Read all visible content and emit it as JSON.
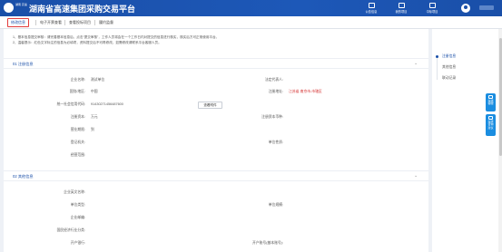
{
  "header": {
    "logo_text": "湖南\n高速",
    "title": "湖南省高速集团采购交易平台",
    "nav": [
      {
        "label": "公告信息",
        "icon": "announcement-icon"
      },
      {
        "label": "我的项目",
        "icon": "project-icon"
      },
      {
        "label": "中标项目",
        "icon": "winning-bid-icon"
      }
    ]
  },
  "tabs": [
    {
      "label": "修改信息",
      "active": true
    },
    {
      "label": "电子开票查看",
      "active": false
    },
    {
      "label": "查看投标项目",
      "active": false
    },
    {
      "label": "履约监督",
      "active": false
    }
  ],
  "notices": [
    "1、基本信息提交审核：请完善基本信息后，点击“提交审核”，工作人员将会在一个工作日内对提交的信息进行核实，核实后方可正常使用平台。",
    "2、温馨提示：红色文字标注的信息为必填项，资料提交后不可再修改，如需修改请联系平台客服人员。"
  ],
  "sections": {
    "registration": {
      "title": "01  注册信息",
      "fields": [
        {
          "label": "企业名称:",
          "value": "测试单位"
        },
        {
          "label": "法定代表人:",
          "value": ""
        },
        {
          "label": "国别/地区:",
          "value": "中国"
        },
        {
          "label": "注册地址:",
          "value": "江苏省-南京市-市辖区"
        },
        {
          "label": "统一社会信用代码:",
          "value": "91430271456487600"
        },
        {
          "label": "注册资本:",
          "value": "万元"
        },
        {
          "label": "注册资本币种:",
          "value": ""
        },
        {
          "label": "营业期限:",
          "value": "到"
        },
        {
          "label": "登记机关:",
          "value": ""
        },
        {
          "label": "单位性质:",
          "value": ""
        },
        {
          "label": "经营范围:",
          "value": ""
        }
      ],
      "view_button": "查看附件"
    },
    "other": {
      "title": "02  其他信息",
      "fields": [
        {
          "label": "企业英文名称:",
          "value": ""
        },
        {
          "label": "单位类型:",
          "value": ""
        },
        {
          "label": "单位规模:",
          "value": ""
        },
        {
          "label": "企业邮编:",
          "value": ""
        },
        {
          "label": "国民经济行业分类:",
          "value": ""
        },
        {
          "label": "开户银行:",
          "value": ""
        },
        {
          "label": "开户账号(基本账号):",
          "value": ""
        }
      ]
    }
  },
  "anchors": [
    {
      "label": "注册信息",
      "active": true
    },
    {
      "label": "其他信息",
      "active": false
    },
    {
      "label": "联动记录",
      "active": false
    }
  ],
  "float_buttons": [
    "在线\n客服",
    "在线\n咨询\n建议"
  ],
  "colors": {
    "brand": "#1a4fa8",
    "required": "#d43030",
    "float": "#1a8de0"
  }
}
